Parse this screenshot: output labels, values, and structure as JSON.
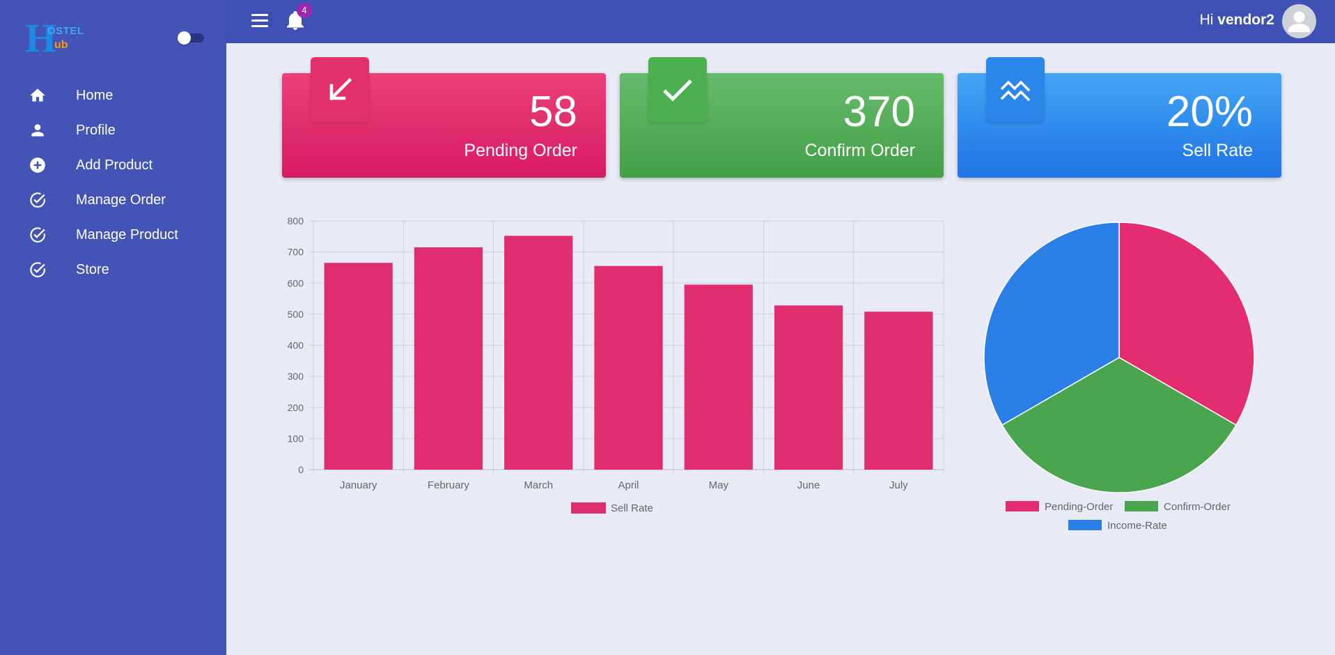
{
  "sidebar": {
    "logo": {
      "letter_h": "H",
      "ostel": "OSTEL",
      "ub": "ub"
    },
    "items": [
      {
        "label": "Home",
        "icon": "home-icon"
      },
      {
        "label": "Profile",
        "icon": "person-icon"
      },
      {
        "label": "Add Product",
        "icon": "add-circle-icon"
      },
      {
        "label": "Manage Order",
        "icon": "check-circle-icon"
      },
      {
        "label": "Manage Product",
        "icon": "check-circle-icon"
      },
      {
        "label": "Store",
        "icon": "check-circle-icon"
      }
    ]
  },
  "topbar": {
    "notification_count": "4",
    "greeting": "Hi",
    "username": "vendor2"
  },
  "cards": [
    {
      "value": "58",
      "label": "Pending Order",
      "icon": "arrow-down-left-icon",
      "color": "#e91e63"
    },
    {
      "value": "370",
      "label": "Confirm Order",
      "icon": "check-icon",
      "color": "#4caf50"
    },
    {
      "value": "20%",
      "label": "Sell Rate",
      "icon": "trend-lines-icon",
      "color": "#2196f3"
    }
  ],
  "chart_data": [
    {
      "type": "bar",
      "categories": [
        "January",
        "February",
        "March",
        "April",
        "May",
        "June",
        "July"
      ],
      "series": [
        {
          "name": "Sell Rate",
          "values": [
            665,
            715,
            752,
            655,
            595,
            528,
            508
          ],
          "color": "#e02d6e"
        }
      ],
      "ylim": [
        0,
        800
      ],
      "yticks": [
        0,
        100,
        200,
        300,
        400,
        500,
        600,
        700,
        800
      ],
      "grid": true,
      "legend": "bottom"
    },
    {
      "type": "pie",
      "categories": [
        "Pending-Order",
        "Confirm-Order",
        "Income-Rate"
      ],
      "values": [
        1,
        1,
        1
      ],
      "colors": [
        "#e42d6e",
        "#4aa64e",
        "#2a7fe6"
      ],
      "legend": "bottom"
    }
  ]
}
